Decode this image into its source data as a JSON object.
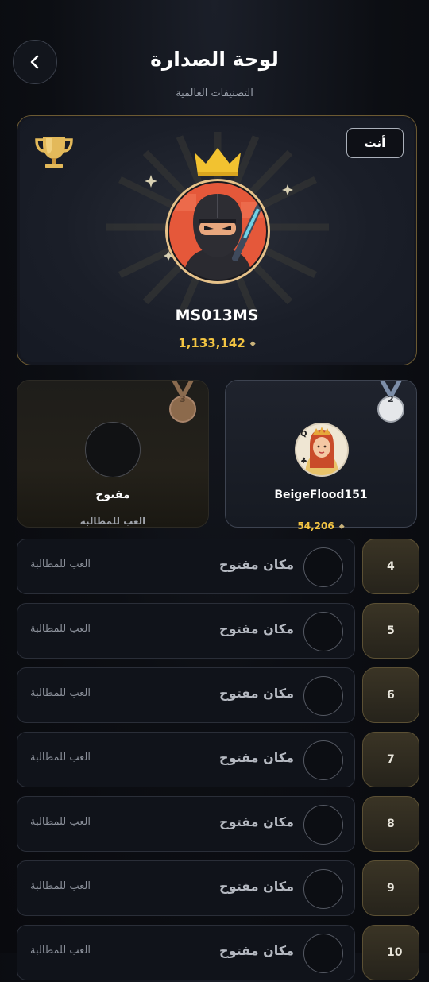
{
  "header": {
    "title": "لوحة الصدارة",
    "subtitle": "التصنيفات العالمية"
  },
  "hero": {
    "you_badge": "أنت",
    "name": "MS013MS",
    "score": "1,133,142",
    "score_icon": "diamond-icon",
    "rank_icon": "trophy-icon"
  },
  "podium": {
    "second": {
      "rank": "2",
      "name": "BeigeFlood151",
      "score": "54,206"
    },
    "third": {
      "rank": "3",
      "name": "مفتوح",
      "sub": "العب للمطالبة"
    }
  },
  "rows": [
    {
      "rank": "4",
      "label": "مكان مفتوح",
      "action": "العب للمطالبة"
    },
    {
      "rank": "5",
      "label": "مكان مفتوح",
      "action": "العب للمطالبة"
    },
    {
      "rank": "6",
      "label": "مكان مفتوح",
      "action": "العب للمطالبة"
    },
    {
      "rank": "7",
      "label": "مكان مفتوح",
      "action": "العب للمطالبة"
    },
    {
      "rank": "8",
      "label": "مكان مفتوح",
      "action": "العب للمطالبة"
    },
    {
      "rank": "9",
      "label": "مكان مفتوح",
      "action": "العب للمطالبة"
    },
    {
      "rank": "10",
      "label": "مكان مفتوح",
      "action": "العب للمطالبة"
    }
  ],
  "colors": {
    "gold": "#f4c542",
    "bronze": "#8c6a4c",
    "silver": "#c9ccd2"
  }
}
